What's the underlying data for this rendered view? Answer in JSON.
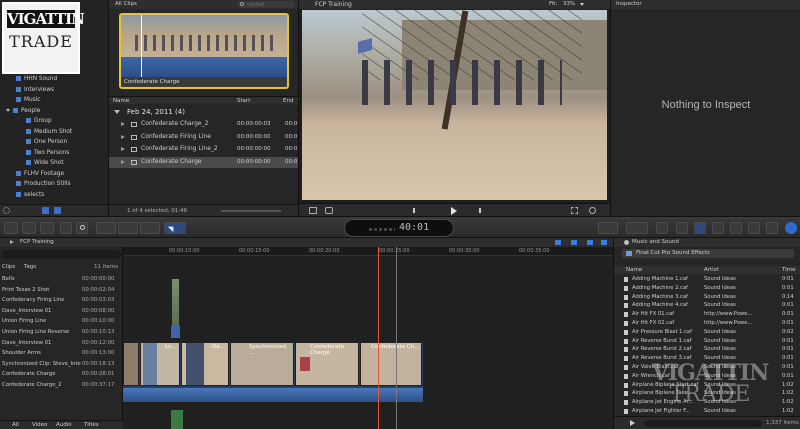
{
  "logo": {
    "line1": "VIGATTIN",
    "line2": "TRADE"
  },
  "watermark": {
    "line1": "VIGATTIN",
    "line2": "TRADE"
  },
  "library": {
    "items": [
      {
        "label": "HHN Sound",
        "indent": 1
      },
      {
        "label": "Interviews",
        "indent": 1
      },
      {
        "label": "Music",
        "indent": 1
      },
      {
        "label": "People",
        "indent": 0
      },
      {
        "label": "Group",
        "indent": 2
      },
      {
        "label": "Medium Shot",
        "indent": 2
      },
      {
        "label": "One Person",
        "indent": 2
      },
      {
        "label": "Two Persons",
        "indent": 2
      },
      {
        "label": "Wide Shot",
        "indent": 2
      },
      {
        "label": "FLHV Footage",
        "indent": 1
      },
      {
        "label": "Production Stills",
        "indent": 1
      },
      {
        "label": "selects",
        "indent": 1
      }
    ]
  },
  "browser": {
    "header": "All Clips",
    "search_placeholder": "confed",
    "filmstrip_caption": "Confederate Charge",
    "columns": {
      "name": "Name",
      "start": "Start",
      "end": "End"
    },
    "group": "Feb 24, 2011  (4)",
    "clips": [
      {
        "name": "Confederate Charge_2",
        "start": "00:00:00:03",
        "end": "00:0"
      },
      {
        "name": "Confederate Firing Line",
        "start": "00:00:00:00",
        "end": "00:0"
      },
      {
        "name": "Confederate Firing Line_2",
        "start": "00:00:00:00",
        "end": "00:0"
      },
      {
        "name": "Confederate Charge",
        "start": "00:00:00:00",
        "end": "00:0"
      }
    ],
    "status": "1 of 4 selected, 01:46"
  },
  "viewer": {
    "title": "FCP Training",
    "fit_label": "Fit:",
    "fit_value": "33%"
  },
  "inspector": {
    "title": "Inspector",
    "empty_message": "Nothing to Inspect"
  },
  "timecode": "40:01",
  "timeline_index": {
    "title": "FCP Training",
    "tabs": {
      "clips": "Clips",
      "tags": "Tags"
    },
    "count": "11 items",
    "rows": [
      {
        "name": "Bells",
        "time": "00:00:00:00"
      },
      {
        "name": "Print Texas 2 Shot",
        "time": "00:00:02:04"
      },
      {
        "name": "Confederacy Firing Line",
        "time": "00:00:03:03"
      },
      {
        "name": "Dave_Interview 01",
        "time": "00:00:08:00"
      },
      {
        "name": "Union Firing Line",
        "time": "00:00:10:00"
      },
      {
        "name": "Union Firing Line Reverse",
        "time": "00:00:10:13"
      },
      {
        "name": "Dave_Interview 01",
        "time": "00:00:12:00"
      },
      {
        "name": "Shoulder Arms",
        "time": "00:00:13:00"
      },
      {
        "name": "Synchronized Clip: Steve_Inte",
        "time": "00:00:18:13"
      },
      {
        "name": "Confederate Charge",
        "time": "00:00:28:01"
      },
      {
        "name": "Confederate Charge_2",
        "time": "00:00:37:17"
      }
    ],
    "bottom_tabs": {
      "all": "All",
      "video": "Video",
      "audio": "Audio",
      "titles": "Titles"
    }
  },
  "timeline": {
    "ruler": [
      "00:00:10:00",
      "00:00:15:00",
      "00:00:20:00",
      "00:00:25:00",
      "00:00:30:00",
      "00:00:35:00"
    ],
    "clip_labels": [
      "Lo...",
      "Da...",
      "Synchronized ...",
      "Confederate Charge",
      "Confederate Ch..."
    ]
  },
  "music_sound": {
    "title": "Music and Sound",
    "source": "Final Cut Pro Sound Effects",
    "columns": {
      "name": "Name",
      "artist": "Artist",
      "time": "Time"
    },
    "items": [
      {
        "name": "Adding Machine 1.caf",
        "artist": "Sound Ideas",
        "time": "0:01"
      },
      {
        "name": "Adding Machine 2.caf",
        "artist": "Sound Ideas",
        "time": "0:01"
      },
      {
        "name": "Adding Machine 3.caf",
        "artist": "Sound Ideas",
        "time": "0:14"
      },
      {
        "name": "Adding Machine 4.caf",
        "artist": "Sound Ideas",
        "time": "0:01"
      },
      {
        "name": "Air Hit FX 01.caf",
        "artist": "http://www.Powe...",
        "time": "0:01"
      },
      {
        "name": "Air Hit FX 02.caf",
        "artist": "http://www.Powe...",
        "time": "0:01"
      },
      {
        "name": "Air Pressure Blast 1.caf",
        "artist": "Sound Ideas",
        "time": "0:02"
      },
      {
        "name": "Air Reverse Burst 1.caf",
        "artist": "Sound Ideas",
        "time": "0:01"
      },
      {
        "name": "Air Reverse Burst 2.caf",
        "artist": "Sound Ideas",
        "time": "0:01"
      },
      {
        "name": "Air Reverse Burst 3.caf",
        "artist": "Sound Ideas",
        "time": "0:01"
      },
      {
        "name": "Air Valve Blast.caf",
        "artist": "Sound Ideas",
        "time": "0:01"
      },
      {
        "name": "Air Wrench.caf",
        "artist": "Sound Ideas",
        "time": "0:01"
      },
      {
        "name": "Airplane Biplane Start.caf",
        "artist": "Sound Ideas",
        "time": "1:02"
      },
      {
        "name": "Airplane Biplane Take...",
        "artist": "Sound Ideas",
        "time": "1:02"
      },
      {
        "name": "Airplane Jet Engine Ar...",
        "artist": "Sound Ideas",
        "time": "1:02"
      },
      {
        "name": "Airplane Jet Fighter F...",
        "artist": "Sound Ideas",
        "time": "1:02"
      }
    ],
    "count": "1,337 items"
  }
}
